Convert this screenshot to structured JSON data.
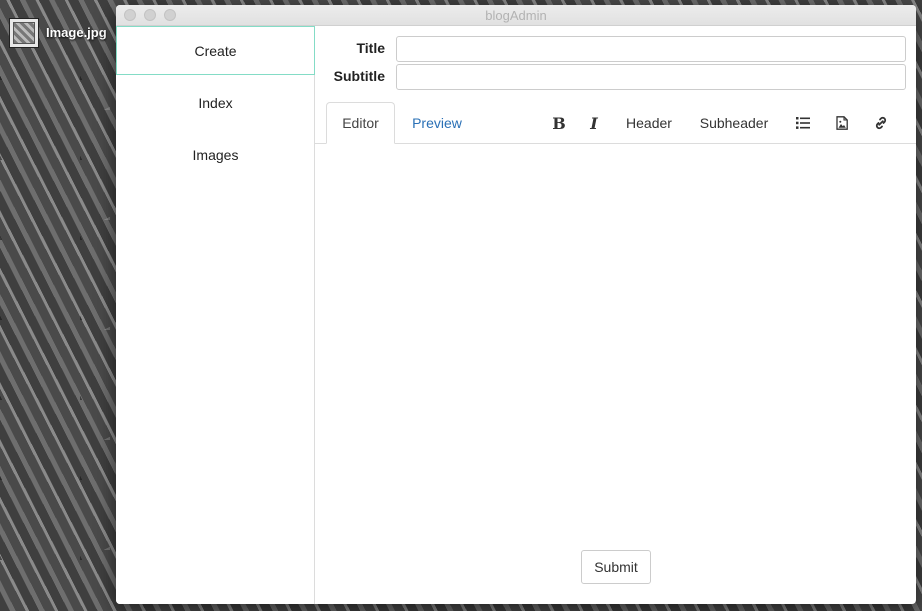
{
  "desktop": {
    "icon_label": "Image.jpg"
  },
  "window": {
    "title": "blogAdmin"
  },
  "sidebar": {
    "items": [
      {
        "label": "Create",
        "active": true
      },
      {
        "label": "Index",
        "active": false
      },
      {
        "label": "Images",
        "active": false
      }
    ]
  },
  "form": {
    "title_label": "Title",
    "title_value": "",
    "subtitle_label": "Subtitle",
    "subtitle_value": ""
  },
  "tabs": [
    {
      "label": "Editor",
      "active": true
    },
    {
      "label": "Preview",
      "active": false
    }
  ],
  "toolbar": {
    "bold_label": "B",
    "italic_label": "I",
    "header_label": "Header",
    "subheader_label": "Subheader",
    "icons": [
      "list-icon",
      "image-icon",
      "link-icon"
    ]
  },
  "editor": {
    "content": ""
  },
  "actions": {
    "submit_label": "Submit"
  },
  "colors": {
    "active_sidebar_border": "#84dcc6",
    "link_tab": "#2a70b6",
    "title_text": "#b2b2b2"
  }
}
